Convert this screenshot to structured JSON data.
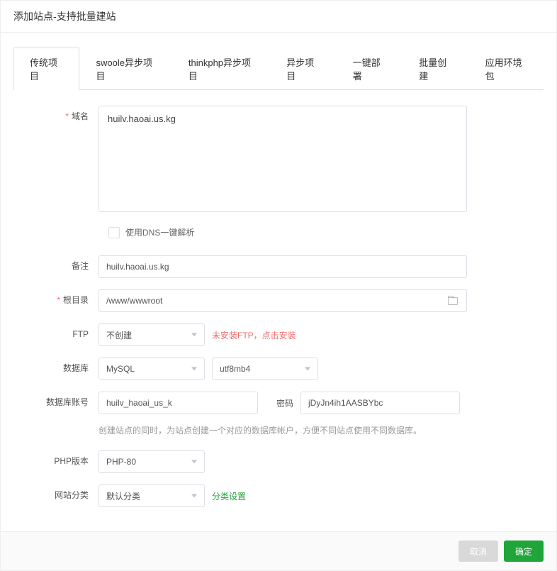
{
  "header": {
    "title": "添加站点-支持批量建站"
  },
  "tabs": [
    {
      "label": "传统项目",
      "active": true
    },
    {
      "label": "swoole异步项目"
    },
    {
      "label": "thinkphp异步项目"
    },
    {
      "label": "异步项目"
    },
    {
      "label": "一键部署"
    },
    {
      "label": "批量创建"
    },
    {
      "label": "应用环境包"
    }
  ],
  "form": {
    "domain": {
      "label": "域名",
      "value": "huilv.haoai.us.kg",
      "required": true
    },
    "dns_checkbox": {
      "label": "使用DNS一键解析"
    },
    "remark": {
      "label": "备注",
      "value": "huilv.haoai.us.kg"
    },
    "root": {
      "label": "根目录",
      "value": "/www/wwwroot",
      "required": true
    },
    "ftp": {
      "label": "FTP",
      "value": "不创建",
      "hint": "未安装FTP，点击安装"
    },
    "db": {
      "label": "数据库",
      "type_value": "MySQL",
      "charset_value": "utf8mb4"
    },
    "db_account": {
      "label": "数据库账号",
      "user_value": "huilv_haoai_us_k",
      "password_label": "密码",
      "password_value": "jDyJn4ih1AASBYbc",
      "hint": "创建站点的同时，为站点创建一个对应的数据库帐户，方便不同站点使用不同数据库。"
    },
    "php": {
      "label": "PHP版本",
      "value": "PHP-80"
    },
    "category": {
      "label": "网站分类",
      "value": "默认分类",
      "link": "分类设置"
    }
  },
  "footer": {
    "cancel": "取消",
    "confirm": "确定"
  }
}
